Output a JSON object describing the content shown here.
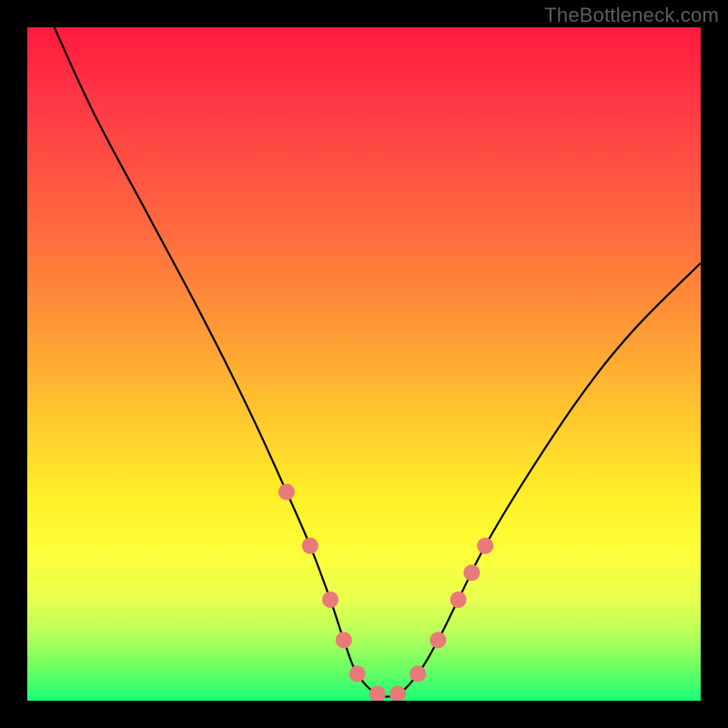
{
  "watermark": "TheBottleneck.com",
  "chart_data": {
    "type": "line",
    "title": "",
    "xlabel": "",
    "ylabel": "",
    "xlim": [
      0,
      100
    ],
    "ylim": [
      0,
      100
    ],
    "series": [
      {
        "name": "curve",
        "x": [
          4,
          10,
          18,
          26,
          33,
          38.5,
          42,
          45,
          47,
          49,
          52,
          55,
          58,
          61,
          64,
          68,
          74,
          82,
          90,
          100
        ],
        "y": [
          100,
          87,
          72,
          57,
          43,
          31,
          23,
          15,
          9,
          4,
          1,
          1,
          4,
          9,
          15,
          23,
          33,
          45,
          55,
          65
        ]
      }
    ],
    "markers": {
      "name": "highlight-dots",
      "color": "#e97a7a",
      "points": [
        {
          "x": 38.5,
          "y": 31
        },
        {
          "x": 42,
          "y": 23
        },
        {
          "x": 45,
          "y": 15
        },
        {
          "x": 47,
          "y": 9
        },
        {
          "x": 49,
          "y": 4
        },
        {
          "x": 52,
          "y": 1
        },
        {
          "x": 55,
          "y": 1
        },
        {
          "x": 58,
          "y": 4
        },
        {
          "x": 61,
          "y": 9
        },
        {
          "x": 64,
          "y": 15
        },
        {
          "x": 66,
          "y": 19
        },
        {
          "x": 68,
          "y": 23
        }
      ]
    },
    "gradient_stops": [
      {
        "pos": 0,
        "color": "#ff1a3d"
      },
      {
        "pos": 50,
        "color": "#ffc82e"
      },
      {
        "pos": 80,
        "color": "#fdff3a"
      },
      {
        "pos": 100,
        "color": "#1aff76"
      }
    ]
  }
}
